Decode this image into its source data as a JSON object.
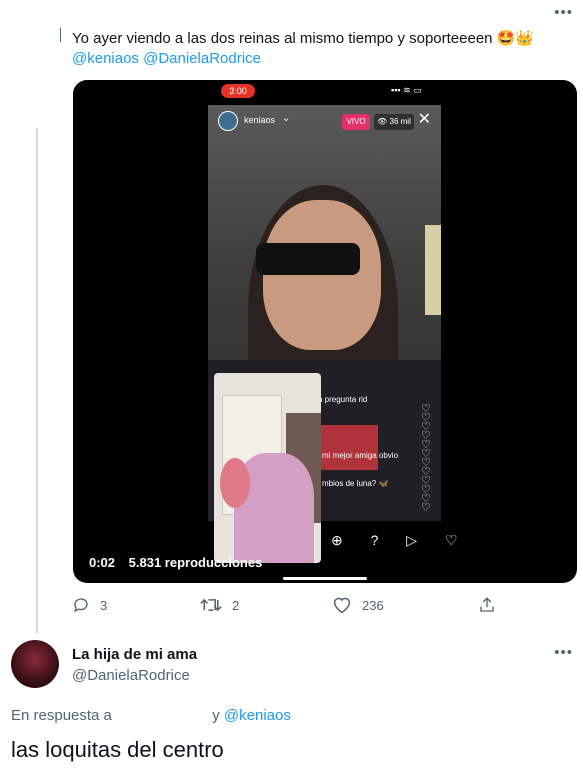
{
  "tweet": {
    "text": "Yo ayer viendo a las dos reinas al mismo tiempo y soporteeeen",
    "emojis": "🤩👑",
    "mentions": [
      "@keniaos",
      "@DanielaRodrice"
    ]
  },
  "video": {
    "time": "0:02",
    "views": "5.831 reproducciones",
    "phone": {
      "status_time": "3:00",
      "status_right": "▪▪▪ ≋ ▭",
      "username": "keniaos",
      "chevron": "⌄",
      "live_label": "VIVO",
      "viewers": "👁 36 mil",
      "close": "✕",
      "comments": [
        "a pregunta rid",
        "mi mejor amiga obvio",
        "mbios de luna? 🦋"
      ],
      "actions": "⊕ ? ▷ ♡"
    }
  },
  "actions": {
    "replies": "3",
    "retweets": "2",
    "likes": "236",
    "icons": {
      "reply": "reply-icon",
      "retweet": "retweet-icon",
      "like": "heart-icon",
      "share": "share-icon"
    }
  },
  "reply": {
    "name": "La hija de mi ama",
    "handle": "@DanielaRodrice",
    "in_reply_prefix": "En respuesta a",
    "in_reply_joiner": "y",
    "in_reply_mention": "@keniaos",
    "text": "las loquitas del centro"
  },
  "more_icon": "•••"
}
